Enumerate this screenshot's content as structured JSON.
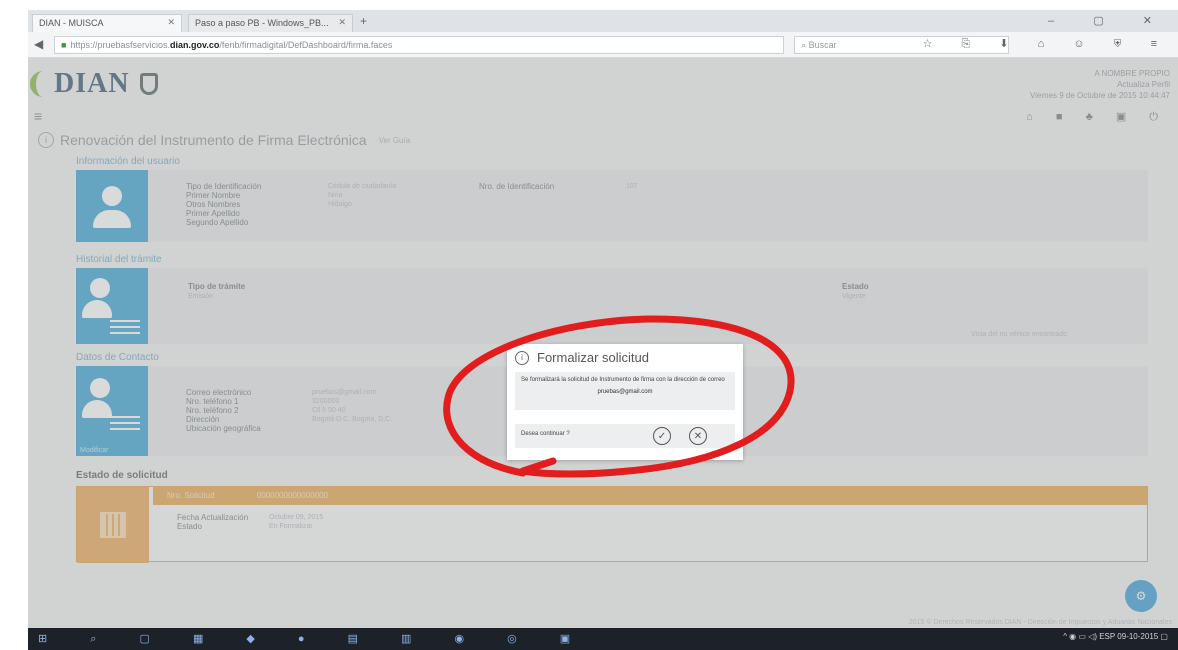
{
  "browser": {
    "tabs": [
      {
        "label": "DIAN - MUISCA"
      },
      {
        "label": "Paso a paso PB - Windows_PB..."
      }
    ],
    "new_tab": "+",
    "url_prefix": "https://pruebasfservicios",
    "url_domain": "dian.gov.co",
    "url_path": "/fenb/firmadigital/DefDashboard/firma.faces",
    "search_placeholder": "Buscar",
    "window_controls": "– ▢ ✕",
    "toolbar_icons": "☆ ⎘ ⬇ ⌂ ☺ ⛨ ≡"
  },
  "page": {
    "logo_text": "DIAN",
    "user_line1": "A NOMBRE PROPIO",
    "user_line2": "Actualiza Perfil",
    "user_line3": "Viernes 9 de Octubre de 2015 10:44:47",
    "header_icons": "⌂ ■ ♣ ▣ ⏻",
    "title": "Renovación del Instrumento de Firma Electrónica",
    "title_note": "Ver Guía",
    "sections": {
      "user_info": "Información del usuario",
      "procedure_history": "Historial del trámite",
      "contact_data": "Datos de Contacto",
      "request_status": "Estado de solicitud"
    },
    "user_fields": [
      "Tipo de Identificación",
      "Primer Nombre",
      "Otros Nombres",
      "Primer Apellido",
      "Segundo Apellido"
    ],
    "user_values": [
      "Cédula de ciudadanía",
      "Nina",
      "",
      "Hidalgo",
      ""
    ],
    "id_label": "Nro. de Identificación",
    "id_value": "107",
    "procedure_type_label": "Tipo de trámite",
    "procedure_type_value": "Emisión",
    "procedure_state_label": "Estado",
    "procedure_state_value": "Vigente",
    "procedure_note": "Vista del no vértice encontrado",
    "contact_fields": [
      "Correo electrónico",
      "Nro. teléfono 1",
      "Nro. teléfono 2",
      "Dirección",
      "Ubicación geográfica"
    ],
    "contact_values": [
      "pruebas@gmail.com",
      "3200000",
      "",
      "Cll 5 50 40",
      "Bogotá D.C. Bogotá, D.C."
    ],
    "edit_label": "Modificar",
    "request_number_label": "Nro. Solicitud",
    "request_number_value": "0000000000000000",
    "request_fields": [
      "Fecha Actualización",
      "Estado"
    ],
    "request_values": [
      "Octubre 09, 2015",
      "En Formalizar"
    ],
    "footer": "2015 © Derechos Reservados DIAN - Dirección de Impuestos y Aduanas Nacionales",
    "fab_icon": "⚙"
  },
  "modal": {
    "title": "Formalizar solicitud",
    "message": "Se formalizará la solicitud de Instrumento de firma con la dirección de correo",
    "email": "pruebas@gmail.com",
    "confirm_question": "Desea continuar ?",
    "confirm_icon": "✓",
    "cancel_icon": "✕"
  },
  "taskbar": {
    "icons": "⊞ ⌕ ▢ ▦ ◆ ● ▤ ▥ ◉ ◎ ▣",
    "tray": "^ ◉ ▭ ◁) ESP 09-10-2015 ▢"
  },
  "colors": {
    "accent": "#2c9fd3",
    "orange": "#e8a040",
    "annotation": "#e21d1d"
  }
}
